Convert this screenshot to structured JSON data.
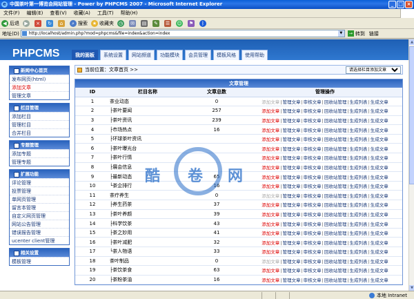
{
  "window": {
    "title": "中国茶叶第一博览会网站管理 - Power by PHPCMS 2007 - Microsoft Internet Explorer"
  },
  "menubar": [
    "文件(F)",
    "编辑(E)",
    "查看(V)",
    "收藏(A)",
    "工具(T)",
    "帮助(H)"
  ],
  "toolbar": {
    "back": "后退",
    "search": "搜索",
    "favorites": "收藏夹"
  },
  "address": {
    "label": "地址(D)",
    "url": "http://localhost/admin.php?mod=phpcms&file=index&action=index",
    "go": "转到",
    "links": "链接"
  },
  "app": {
    "logo": "PHPCMS",
    "tabs": [
      "我的面板",
      "系统设置",
      "网站频道",
      "功能模块",
      "会员管理",
      "模板风格",
      "使用帮助"
    ]
  },
  "sidebar": [
    {
      "title": "新闻中心首页",
      "items": [
        {
          "label": "发布网页(html)"
        },
        {
          "label": "添加文章",
          "red": true
        },
        {
          "label": "管理文章"
        }
      ]
    },
    {
      "title": "栏目管理",
      "items": [
        {
          "label": "添加栏目"
        },
        {
          "label": "管理栏目"
        },
        {
          "label": "合并栏目"
        }
      ]
    },
    {
      "title": "专题管理",
      "items": [
        {
          "label": "添加专题"
        },
        {
          "label": "管理专题"
        }
      ]
    },
    {
      "title": "扩展功能",
      "items": [
        {
          "label": "评论管理"
        },
        {
          "label": "投票管理"
        },
        {
          "label": "单网页管理"
        },
        {
          "label": "留言本管理"
        },
        {
          "label": "自定义网页管理"
        },
        {
          "label": "网站公告管理"
        },
        {
          "label": "错误报告管理"
        },
        {
          "label": "ucenter client管理"
        }
      ]
    },
    {
      "title": "相关设置",
      "items": [
        {
          "label": "模板管理"
        }
      ]
    }
  ],
  "breadcrumb": {
    "text": "当前位置：文章首页 >>",
    "select": "请选择栏目添加文章"
  },
  "table": {
    "title": "文章管理",
    "headers": [
      "ID",
      "栏目名称",
      "文章总数",
      "管理操作"
    ],
    "ops": [
      "添加文章",
      "管理文章",
      "审核文章",
      "回收站管理",
      "生成列表",
      "生成文章"
    ],
    "rows": [
      {
        "id": "1",
        "name": "茶业动态",
        "count": "0",
        "add": false
      },
      {
        "id": "2",
        "name": "├茶叶要闻",
        "count": "257",
        "add": true
      },
      {
        "id": "3",
        "name": "├茶叶资讯",
        "count": "239",
        "add": true
      },
      {
        "id": "4",
        "name": "├市场热点",
        "count": "16",
        "add": true
      },
      {
        "id": "5",
        "name": "├环球茶叶资讯",
        "count": "",
        "add": true
      },
      {
        "id": "6",
        "name": "├茶叶曝光台",
        "count": "",
        "add": true
      },
      {
        "id": "7",
        "name": "├茶叶行情",
        "count": "",
        "add": true
      },
      {
        "id": "8",
        "name": "├展会信息",
        "count": "",
        "add": true
      },
      {
        "id": "9",
        "name": "├最新动态",
        "count": "65",
        "add": true
      },
      {
        "id": "10",
        "name": "└茶企排行",
        "count": "16",
        "add": true
      },
      {
        "id": "11",
        "name": "茶疗养生",
        "count": "0",
        "add": false
      },
      {
        "id": "12",
        "name": "├养生药茶",
        "count": "37",
        "add": true
      },
      {
        "id": "13",
        "name": "├茶叶养颜",
        "count": "39",
        "add": true
      },
      {
        "id": "14",
        "name": "├科学饮茶",
        "count": "43",
        "add": true
      },
      {
        "id": "15",
        "name": "├茶之妙用",
        "count": "41",
        "add": true
      },
      {
        "id": "16",
        "name": "├茶叶减肥",
        "count": "32",
        "add": true
      },
      {
        "id": "17",
        "name": "└茶人物语",
        "count": "33",
        "add": true
      },
      {
        "id": "18",
        "name": "茶叶制品",
        "count": "0",
        "add": false
      },
      {
        "id": "19",
        "name": "├茶饮茶食",
        "count": "63",
        "add": true
      },
      {
        "id": "20",
        "name": "├茶粉茶油",
        "count": "16",
        "add": true
      }
    ]
  },
  "watermark": {
    "chars": [
      "酷",
      "卷",
      "网"
    ]
  },
  "status": {
    "zone": "本地 Intranet"
  },
  "colors": {
    "accent": "#1f58b2",
    "link": "#1a3a7a",
    "red": "#dd0000"
  }
}
